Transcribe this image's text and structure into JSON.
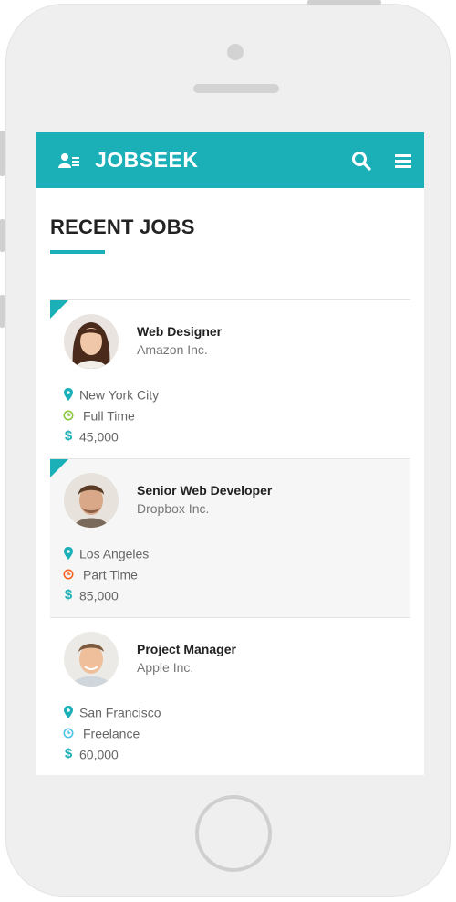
{
  "header": {
    "brand": "JOBSEEK",
    "logo_icon": "user-list-icon",
    "search_icon": "search-icon",
    "menu_icon": "hamburger-menu-icon",
    "color": "#1bb0b8"
  },
  "section": {
    "title": "RECENT JOBS"
  },
  "jobs": [
    {
      "title": "Web Designer",
      "company": "Amazon Inc.",
      "location": "New York City",
      "type": "Full Time",
      "type_color": "#8cc63f",
      "salary": "45,000",
      "featured": true
    },
    {
      "title": "Senior Web Developer",
      "company": "Dropbox Inc.",
      "location": "Los Angeles",
      "type": "Part Time",
      "type_color": "#f26522",
      "salary": "85,000",
      "featured": true
    },
    {
      "title": "Project Manager",
      "company": "Apple Inc.",
      "location": "San Francisco",
      "type": "Freelance",
      "type_color": "#4fc1e9",
      "salary": "60,000",
      "featured": false
    }
  ]
}
